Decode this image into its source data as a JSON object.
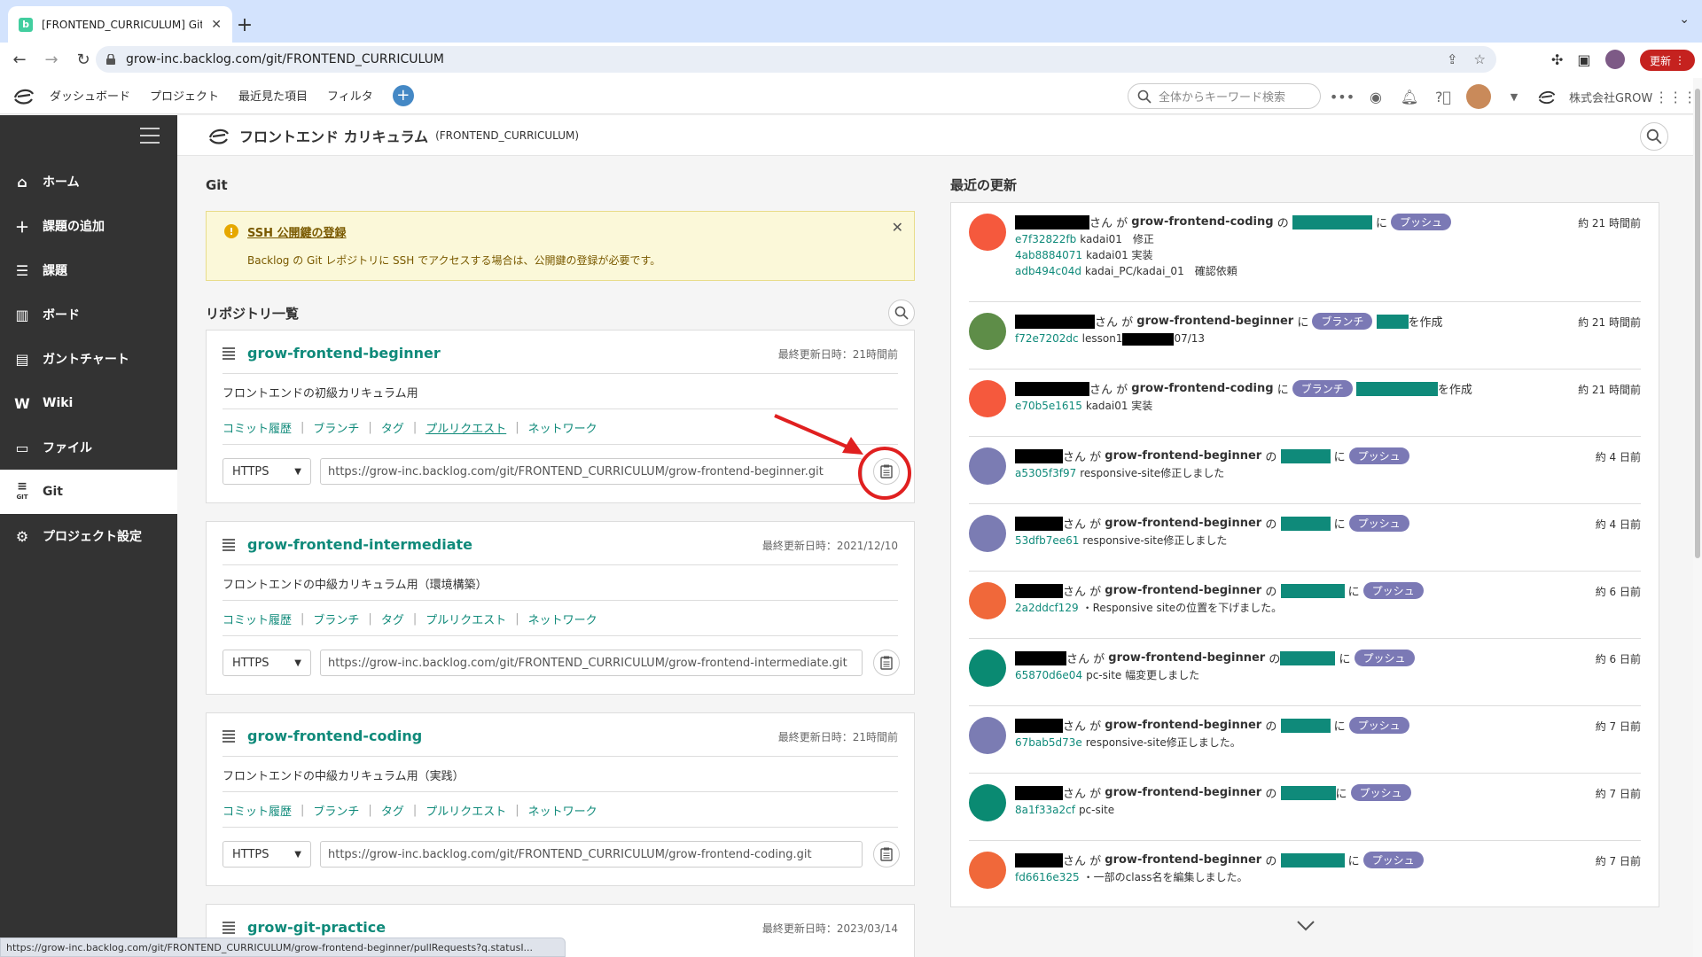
{
  "browser": {
    "tab_title": "[FRONTEND_CURRICULUM] Git",
    "favicon_letter": "b",
    "url": "grow-inc.backlog.com/git/FRONTEND_CURRICULUM",
    "update_label": "更新"
  },
  "global_header": {
    "nav": [
      "ダッシュボード",
      "プロジェクト",
      "最近見た項目",
      "フィルタ"
    ],
    "search_placeholder": "全体からキーワード検索",
    "company": "株式会社GROW"
  },
  "sidebar": {
    "items": [
      {
        "label": "ホーム",
        "icon": "home-icon"
      },
      {
        "label": "課題の追加",
        "icon": "plus-icon"
      },
      {
        "label": "課題",
        "icon": "list-icon"
      },
      {
        "label": "ボード",
        "icon": "board-icon"
      },
      {
        "label": "ガントチャート",
        "icon": "gantt-icon"
      },
      {
        "label": "Wiki",
        "icon": "wiki-icon"
      },
      {
        "label": "ファイル",
        "icon": "file-icon"
      },
      {
        "label": "Git",
        "icon": "git-icon"
      },
      {
        "label": "プロジェクト設定",
        "icon": "gear-icon"
      }
    ],
    "git_sub": "GIT",
    "active": "Git"
  },
  "project": {
    "name": "フロントエンド カリキュラム",
    "key": "(FRONTEND_CURRICULUM)"
  },
  "git_section_title": "Git",
  "warning": {
    "link": "SSH 公開鍵の登録",
    "text": "Backlog の Git レポジトリに SSH でアクセスする場合は、公開鍵の登録が必要です。"
  },
  "repo_list_title": "リポジトリ一覧",
  "repo_links": [
    "コミット履歴",
    "ブランチ",
    "タグ",
    "プルリクエスト",
    "ネットワーク"
  ],
  "protocol": "HTTPS",
  "repos": [
    {
      "name": "grow-frontend-beginner",
      "updated": "最終更新日時：21時間前",
      "desc": "フロントエンドの初級カリキュラム用",
      "url": "https://grow-inc.backlog.com/git/FRONTEND_CURRICULUM/grow-frontend-beginner.git"
    },
    {
      "name": "grow-frontend-intermediate",
      "updated": "最終更新日時：2021/12/10",
      "desc": "フロントエンドの中級カリキュラム用（環境構築）",
      "url": "https://grow-inc.backlog.com/git/FRONTEND_CURRICULUM/grow-frontend-intermediate.git"
    },
    {
      "name": "grow-frontend-coding",
      "updated": "最終更新日時：21時間前",
      "desc": "フロントエンドの中級カリキュラム用（実践）",
      "url": "https://grow-inc.backlog.com/git/FRONTEND_CURRICULUM/grow-frontend-coding.git"
    },
    {
      "name": "grow-git-practice",
      "updated": "最終更新日時：2023/03/14"
    }
  ],
  "recent_title": "最近の更新",
  "recent": [
    {
      "avatar_color": "#f5593d",
      "repo": "grow-frontend-coding",
      "kind": "push",
      "time": "約 21 時間前",
      "commits": [
        {
          "hash": "e7f32822fb",
          "msg": "kadai01　修正"
        },
        {
          "hash": "4ab8884071",
          "msg": "kadai01 実装"
        },
        {
          "hash": "adb494c04d",
          "msg": "kadai_PC/kadai_01　確認依頼"
        }
      ]
    },
    {
      "avatar_color": "#5e8d48",
      "repo": "grow-frontend-beginner",
      "kind": "branch",
      "time": "約 21 時間前",
      "commits": [
        {
          "hash": "f72e7202dc",
          "msg": "lesson1",
          "suffix": "07/13"
        }
      ]
    },
    {
      "avatar_color": "#f5593d",
      "repo": "grow-frontend-coding",
      "kind": "branch",
      "time": "約 21 時間前",
      "commits": [
        {
          "hash": "e70b5e1615",
          "msg": "kadai01 実装"
        }
      ]
    },
    {
      "avatar_color": "#7b7cb3",
      "repo": "grow-frontend-beginner",
      "kind": "push",
      "time": "約 4 日前",
      "commits": [
        {
          "hash": "a5305f3f97",
          "msg": "responsive-site修正しました"
        }
      ]
    },
    {
      "avatar_color": "#7b7cb3",
      "repo": "grow-frontend-beginner",
      "kind": "push",
      "time": "約 4 日前",
      "commits": [
        {
          "hash": "53dfb7ee61",
          "msg": "responsive-site修正しました"
        }
      ]
    },
    {
      "avatar_color": "#f0683a",
      "repo": "grow-frontend-beginner",
      "kind": "push",
      "time": "約 6 日前",
      "commits": [
        {
          "hash": "2a2ddcf129",
          "msg": "・Responsive siteの位置を下げました。"
        }
      ]
    },
    {
      "avatar_color": "#0a8a72",
      "repo": "grow-frontend-beginner",
      "kind": "push",
      "time": "約 6 日前",
      "commits": [
        {
          "hash": "65870d6e04",
          "msg": "pc-site 幅変更しました"
        }
      ]
    },
    {
      "avatar_color": "#7b7cb3",
      "repo": "grow-frontend-beginner",
      "kind": "push",
      "time": "約 7 日前",
      "commits": [
        {
          "hash": "67bab5d73e",
          "msg": "responsive-site修正しました。"
        }
      ]
    },
    {
      "avatar_color": "#0a8a72",
      "repo": "grow-frontend-beginner",
      "kind": "push",
      "time": "約 7 日前",
      "commits": [
        {
          "hash": "8a1f33a2cf",
          "msg": "pc-site"
        }
      ]
    },
    {
      "avatar_color": "#f0683a",
      "repo": "grow-frontend-beginner",
      "kind": "push",
      "time": "約 7 日前",
      "commits": [
        {
          "hash": "fd6616e325",
          "msg": "・一部のclass名を編集しました。"
        }
      ]
    }
  ],
  "strings": {
    "san_ga": "さん が",
    "no": "の",
    "ni": "に",
    "push_tag": "プッシュ",
    "branch_tag": "ブランチ",
    "created": "を作成"
  },
  "status_url": "https://grow-inc.backlog.com/git/FRONTEND_CURRICULUM/grow-frontend-beginner/pullRequests?q.statusI..."
}
